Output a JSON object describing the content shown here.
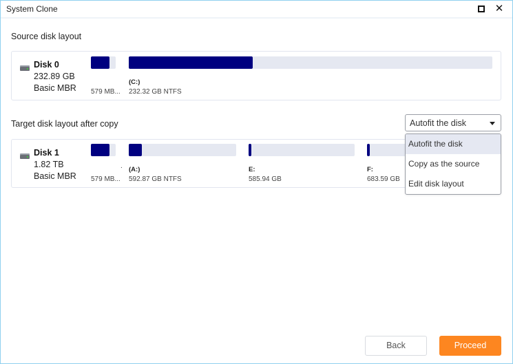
{
  "window": {
    "title": "System Clone",
    "maximize_icon": "maximize-icon",
    "close_icon": "close-icon"
  },
  "source": {
    "section_title": "Source disk layout",
    "disk": {
      "icon": "hard-disk-icon",
      "name": "Disk 0",
      "size": "232.89 GB",
      "type": "Basic MBR",
      "partitions": [
        {
          "label": "",
          "info": "579 MB...",
          "used_fraction": 0.74
        },
        {
          "label": "(C:)",
          "info": "232.32 GB NTFS",
          "used_fraction": 0.34
        }
      ]
    }
  },
  "target": {
    "section_title": "Target disk layout after copy",
    "mode_select": {
      "value": "Autofit the disk",
      "options": [
        "Autofit the disk",
        "Copy as the source",
        "Edit disk layout"
      ],
      "selected_index": 0
    },
    "disk": {
      "icon": "hard-disk-icon",
      "name": "Disk 1",
      "size": "1.82 TB",
      "type": "Basic MBR",
      "partitions": [
        {
          "label": "",
          "info": "579 MB...",
          "used_fraction": 0.74
        },
        {
          "label": "(A:)",
          "info": "592.87 GB NTFS",
          "used_fraction": 0.12
        },
        {
          "label": "E:",
          "info": "585.94 GB",
          "used_fraction": 0.02
        },
        {
          "label": "F:",
          "info": "683.59 GB",
          "used_fraction": 0.02
        }
      ],
      "dot_marker": "."
    }
  },
  "footer": {
    "back_label": "Back",
    "proceed_label": "Proceed"
  },
  "colors": {
    "partition_used": "#000080",
    "partition_free": "#e5e8f1",
    "accent": "#fd8620",
    "window_border": "#8fd0ef"
  }
}
